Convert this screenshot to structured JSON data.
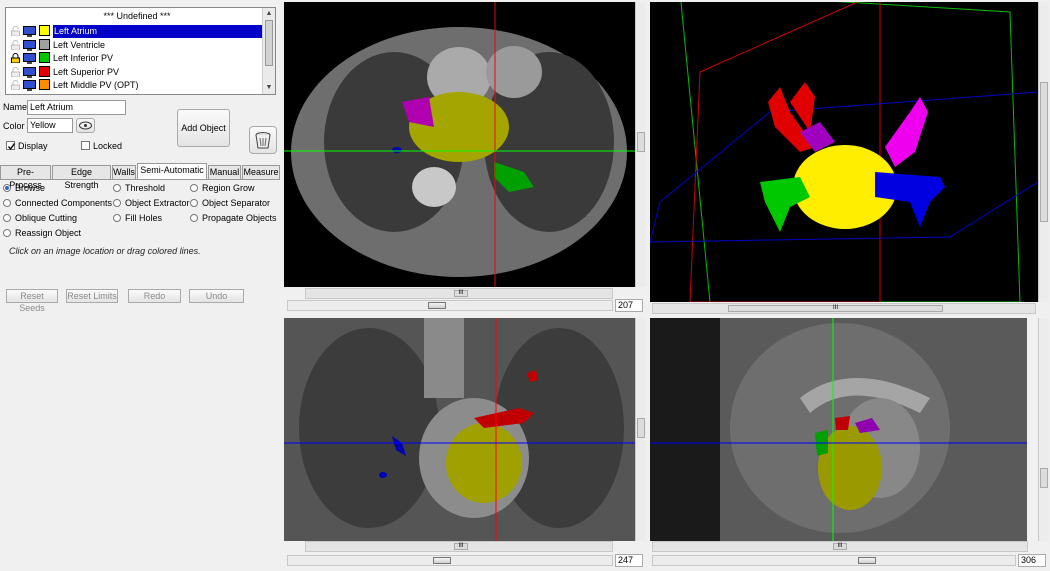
{
  "object_list": {
    "undefined_label": "*** Undefined ***",
    "items": [
      {
        "label": "Left Atrium",
        "color": "#ffff00",
        "selected": true,
        "locked": false
      },
      {
        "label": "Left Ventricle",
        "color": "#a0a0a0",
        "selected": false,
        "locked": false
      },
      {
        "label": "Left Inferior PV",
        "color": "#00c800",
        "selected": false,
        "locked": true
      },
      {
        "label": "Left Superior PV",
        "color": "#e00000",
        "selected": false,
        "locked": false
      },
      {
        "label": "Left Middle PV (OPT)",
        "color": "#ff8c00",
        "selected": false,
        "locked": false
      }
    ]
  },
  "properties": {
    "name_label": "Name",
    "name_value": "Left Atrium",
    "color_label": "Color",
    "color_value": "Yellow",
    "display_label": "Display",
    "display_checked": true,
    "locked_label": "Locked",
    "locked_checked": false,
    "add_object_label": "Add Object"
  },
  "tabs": [
    "Pre-Process",
    "Edge Strength",
    "Walls",
    "Semi-Automatic",
    "Manual",
    "Measure"
  ],
  "active_tab": "Semi-Automatic",
  "tools": [
    {
      "label": "Browse",
      "selected": true
    },
    {
      "label": "Threshold",
      "selected": false
    },
    {
      "label": "Region Grow",
      "selected": false
    },
    {
      "label": "Connected Components",
      "selected": false
    },
    {
      "label": "Object Extractor",
      "selected": false
    },
    {
      "label": "Object Separator",
      "selected": false
    },
    {
      "label": "Oblique Cutting",
      "selected": false
    },
    {
      "label": "Fill Holes",
      "selected": false
    },
    {
      "label": "Propagate Objects",
      "selected": false
    },
    {
      "label": "Reassign Object",
      "selected": false
    }
  ],
  "instruction": "Click on an image location or drag colored lines.",
  "actions": [
    "Reset Seeds",
    "Reset Limits",
    "Redo",
    "Undo"
  ],
  "scroll_grip": "III",
  "views": {
    "axial": {
      "slice": "207"
    },
    "coronal": {
      "slice": "247"
    },
    "sagittal": {
      "slice": "306"
    }
  },
  "colors": {
    "left_atrium": "#ffff00",
    "left_ventricle": "#a0a0a0",
    "left_inferior_pv": "#00c800",
    "left_superior_pv": "#e00000",
    "left_middle_pv": "#ff8c00",
    "selection": "#0000c8",
    "crosshair_vertical": "#ff0000",
    "crosshair_horizontal_axial": "#00ff00",
    "crosshair_horizontal_other": "#0000ff"
  }
}
